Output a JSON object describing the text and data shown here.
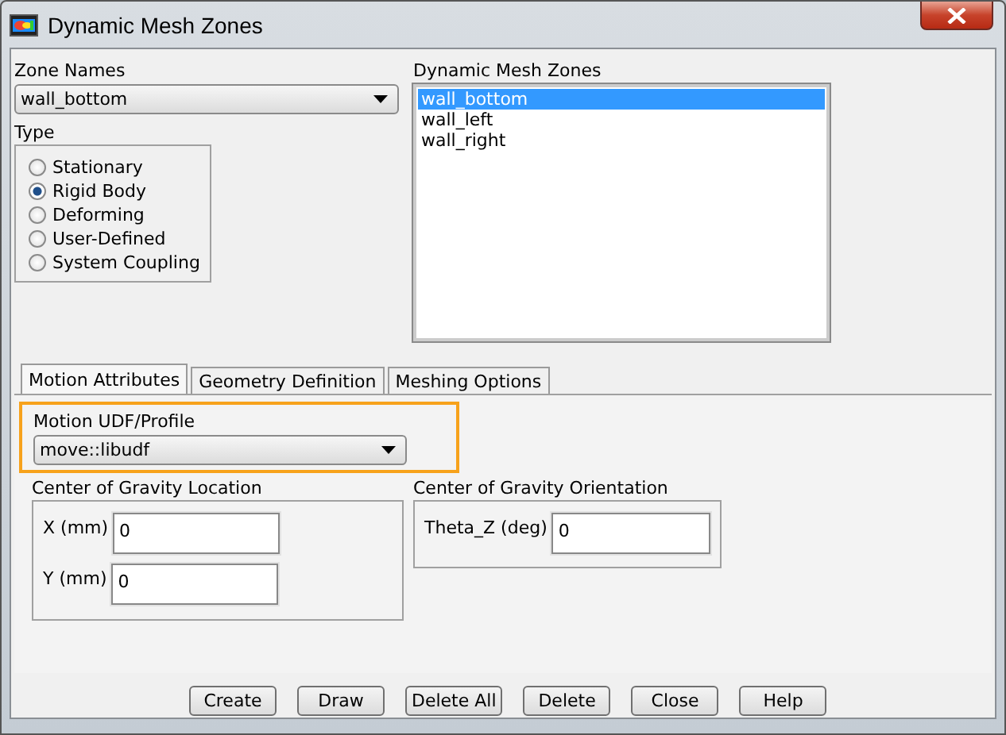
{
  "window": {
    "title": "Dynamic Mesh Zones"
  },
  "zone_names": {
    "label": "Zone Names",
    "value": "wall_bottom"
  },
  "type": {
    "label": "Type",
    "options": [
      {
        "label": "Stationary",
        "selected": false
      },
      {
        "label": "Rigid Body",
        "selected": true
      },
      {
        "label": "Deforming",
        "selected": false
      },
      {
        "label": "User-Defined",
        "selected": false
      },
      {
        "label": "System Coupling",
        "selected": false
      }
    ]
  },
  "dynamic_mesh_zones": {
    "label": "Dynamic Mesh Zones",
    "items": [
      {
        "label": "wall_bottom",
        "selected": true
      },
      {
        "label": "wall_left",
        "selected": false
      },
      {
        "label": "wall_right",
        "selected": false
      }
    ]
  },
  "tabs": [
    {
      "label": "Motion Attributes",
      "selected": true
    },
    {
      "label": "Geometry Definition",
      "selected": false
    },
    {
      "label": "Meshing Options",
      "selected": false
    }
  ],
  "motion_udf": {
    "label": "Motion UDF/Profile",
    "value": "move::libudf"
  },
  "cg_location": {
    "label": "Center of Gravity Location",
    "fields": [
      {
        "label": "X (mm)",
        "value": "0"
      },
      {
        "label": "Y (mm)",
        "value": "0"
      }
    ]
  },
  "cg_orientation": {
    "label": "Center of Gravity Orientation",
    "fields": [
      {
        "label": "Theta_Z (deg)",
        "value": "0"
      }
    ]
  },
  "buttons": [
    "Create",
    "Draw",
    "Delete All",
    "Delete",
    "Close",
    "Help"
  ]
}
